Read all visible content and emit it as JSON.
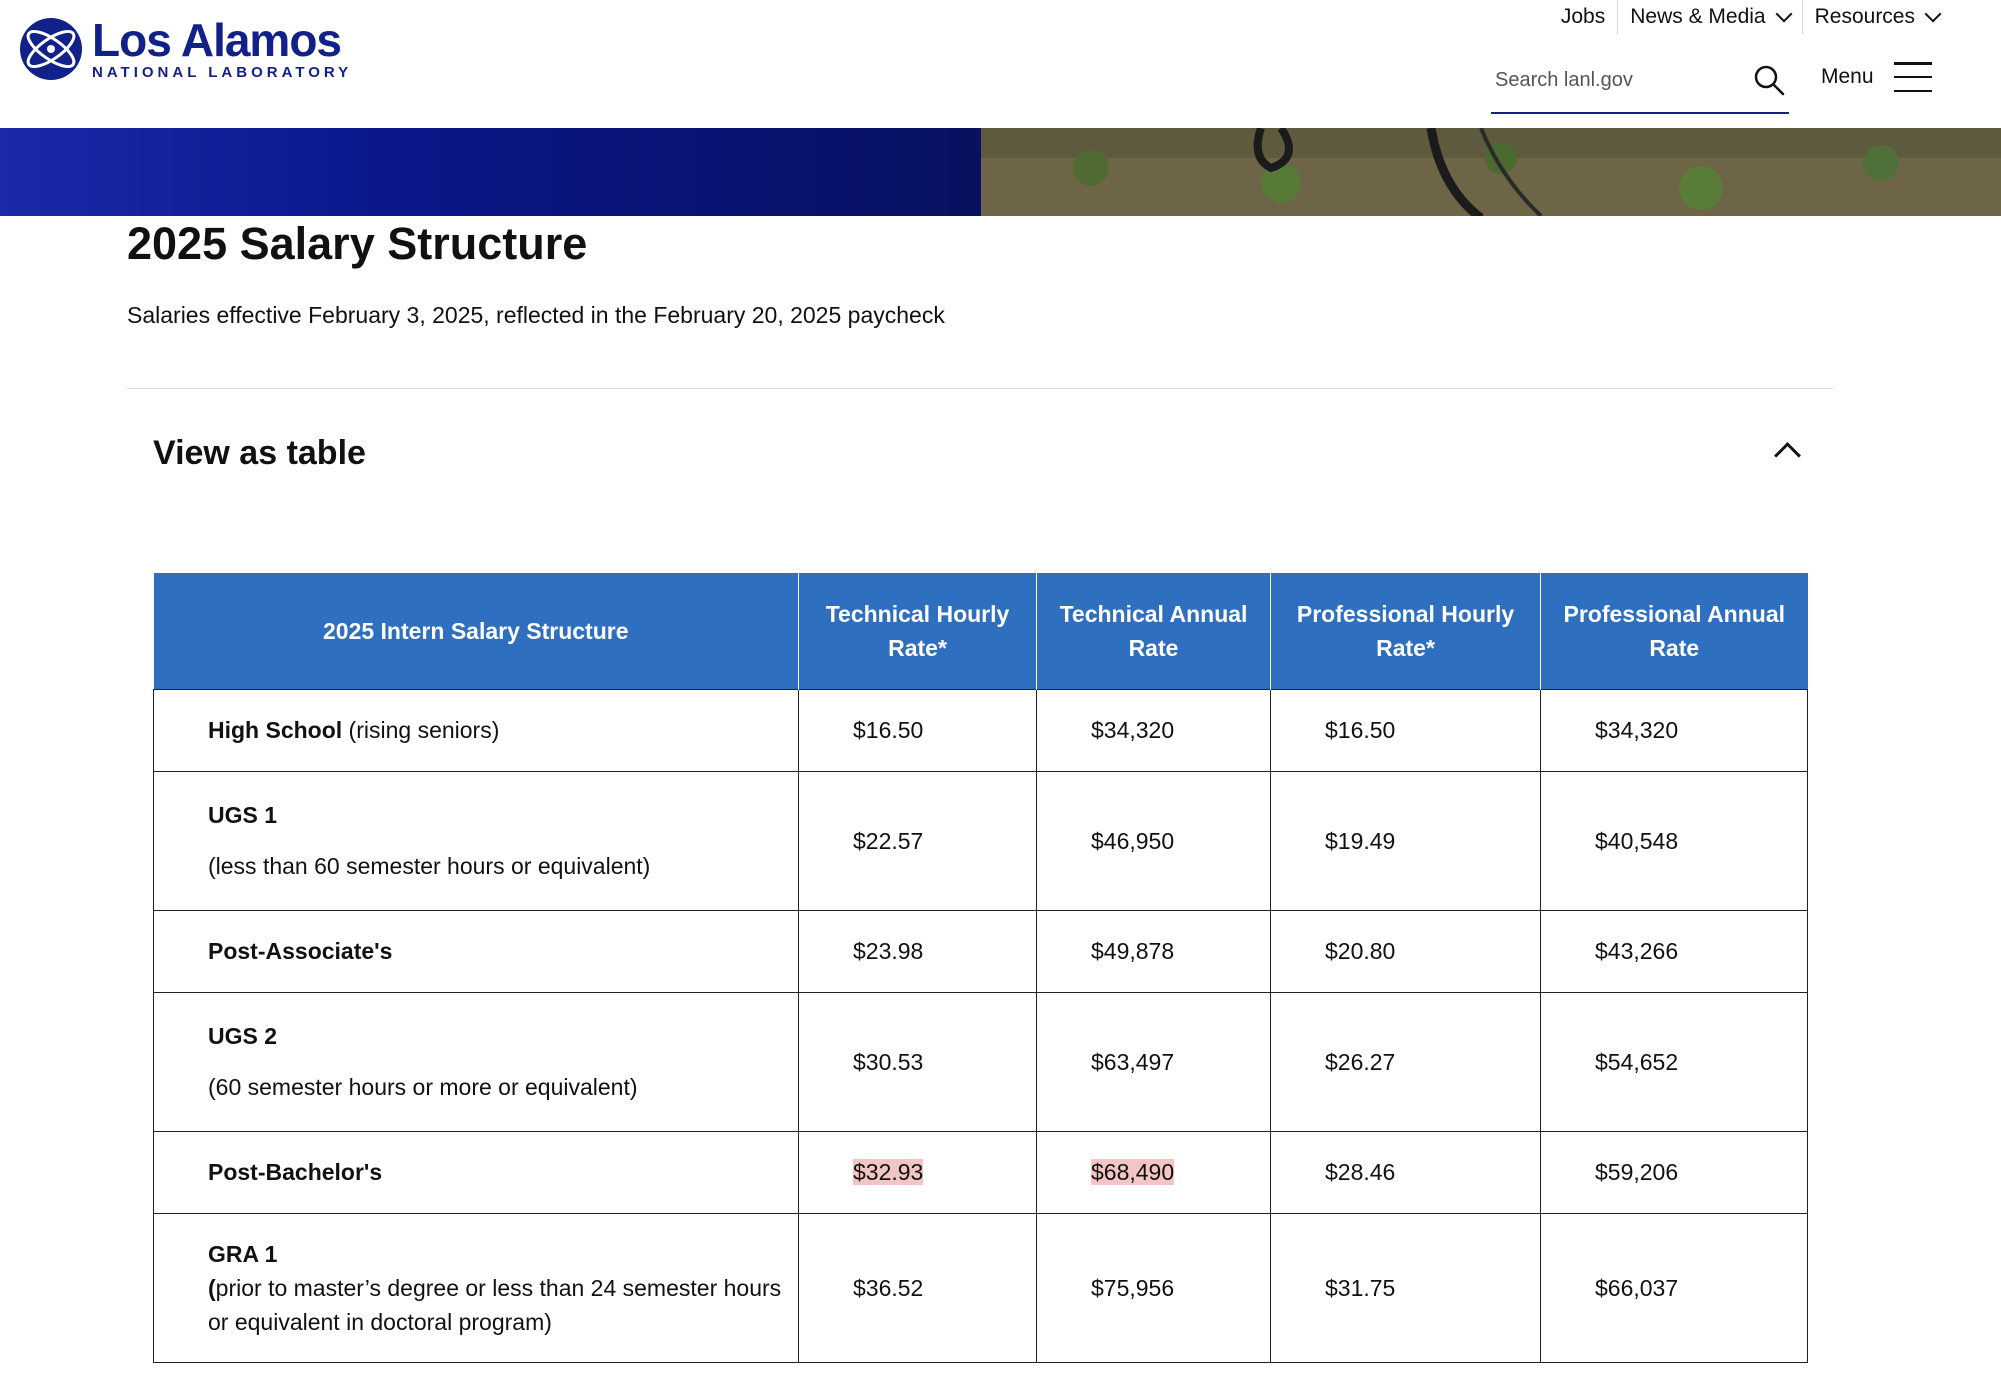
{
  "brand": {
    "name": "Los Alamos",
    "subtitle": "NATIONAL LABORATORY"
  },
  "topnav": {
    "jobs": "Jobs",
    "news": "News & Media",
    "resources": "Resources"
  },
  "search": {
    "placeholder": "Search lanl.gov"
  },
  "menu": {
    "label": "Menu"
  },
  "page": {
    "title": "2025 Salary Structure",
    "subtitle": "Salaries effective February 3, 2025, reflected in the February 20, 2025 paycheck"
  },
  "accordion": {
    "title": "View as table"
  },
  "table": {
    "headers": [
      "2025 Intern Salary Structure",
      "Technical Hourly Rate*",
      "Technical Annual Rate",
      "Professional Hourly Rate*",
      "Professional Annual Rate"
    ],
    "rows": [
      {
        "label": "High School",
        "detail": " (rising seniors)",
        "values": [
          "$16.50",
          "$34,320",
          "$16.50",
          "$34,320"
        ]
      },
      {
        "label": "UGS 1",
        "detail": "(less than 60 semester hours or equivalent)",
        "values": [
          "$22.57",
          "$46,950",
          "$19.49",
          "$40,548"
        ]
      },
      {
        "label": "Post-Associate's",
        "detail": "",
        "values": [
          "$23.98",
          "$49,878",
          "$20.80",
          "$43,266"
        ]
      },
      {
        "label": "UGS 2",
        "detail": "(60 semester hours or more or equivalent)",
        "values": [
          "$30.53",
          "$63,497",
          "$26.27",
          "$54,652"
        ]
      },
      {
        "label": "Post-Bachelor's",
        "detail": "",
        "values": [
          "$32.93",
          "$68,490",
          "$28.46",
          "$59,206"
        ]
      },
      {
        "label": "GRA 1",
        "detail_open": "(",
        "detail": "prior to master’s degree or less than 24 semester hours or equivalent in doctoral program)",
        "values": [
          "$36.52",
          "$75,956",
          "$31.75",
          "$66,037"
        ]
      }
    ]
  },
  "colors": {
    "brand_blue": "#12208a",
    "header_blue": "#2f6fbf",
    "highlight": "#f3c5c5"
  }
}
